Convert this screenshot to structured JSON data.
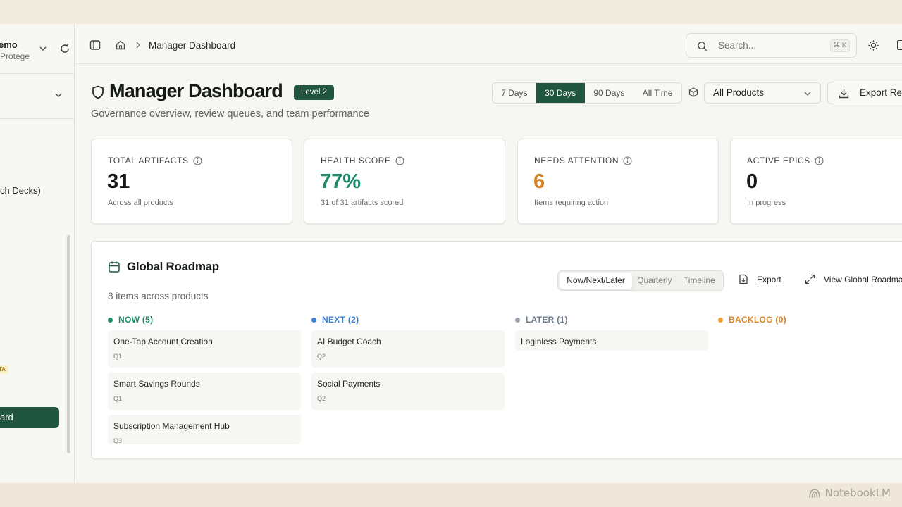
{
  "workspace": {
    "name": "emo",
    "subtitle": "Protege"
  },
  "sidebar": {
    "item_partial": "ch Decks)",
    "beta_badge": "TA",
    "active_item": "ard"
  },
  "topbar": {
    "breadcrumb": "Manager Dashboard",
    "search_placeholder": "Search...",
    "shortcut": "⌘ K"
  },
  "header": {
    "title": "Manager Dashboard",
    "level_badge": "Level 2",
    "subtitle": "Governance overview, review queues, and team performance",
    "ranges": [
      "7 Days",
      "30 Days",
      "90 Days",
      "All Time"
    ],
    "selected_range": "30 Days",
    "product_filter": "All Products",
    "export_label": "Export Re"
  },
  "stats": [
    {
      "label": "TOTAL ARTIFACTS",
      "value": "31",
      "note": "Across all products",
      "color": "#161a17"
    },
    {
      "label": "HEALTH SCORE",
      "value": "77%",
      "note": "31 of 31 artifacts scored",
      "color": "#1d8a6a"
    },
    {
      "label": "NEEDS ATTENTION",
      "value": "6",
      "note": "Items requiring action",
      "color": "#d9852a"
    },
    {
      "label": "ACTIVE EPICS",
      "value": "0",
      "note": "In progress",
      "color": "#161a17"
    }
  ],
  "roadmap": {
    "title": "Global Roadmap",
    "count": "8 items across products",
    "views": [
      "Now/Next/Later",
      "Quarterly",
      "Timeline"
    ],
    "selected_view": "Now/Next/Later",
    "export_label": "Export",
    "view_global_label": "View Global Roadma",
    "columns": [
      {
        "heading": "NOW (5)",
        "color": "#1d8a6a",
        "items": [
          {
            "title": "One-Tap Account Creation",
            "quarter": "Q1"
          },
          {
            "title": "Smart Savings Rounds",
            "quarter": "Q1"
          },
          {
            "title": "Subscription Management Hub",
            "quarter": "Q3"
          }
        ]
      },
      {
        "heading": "NEXT (2)",
        "color": "#3b7fd0",
        "items": [
          {
            "title": "AI Budget Coach",
            "quarter": "Q2"
          },
          {
            "title": "Social Payments",
            "quarter": "Q2"
          }
        ]
      },
      {
        "heading": "LATER (1)",
        "color": "#6b7a8c",
        "dot_color": "#9aa3ad",
        "items": [
          {
            "title": "Loginless Payments",
            "quarter": ""
          }
        ]
      },
      {
        "heading": "BACKLOG (0)",
        "color": "#d9852a",
        "items": []
      }
    ]
  },
  "watermark": "NotebookLM"
}
